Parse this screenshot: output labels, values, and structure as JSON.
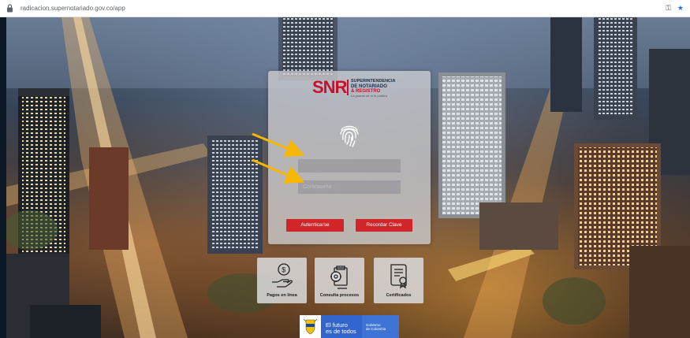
{
  "browser": {
    "url": "radicacion.supernotariado.gov.co/app"
  },
  "logo": {
    "acronym": "SNR",
    "line1": "SUPERINTENDENCIA",
    "line2": "DE NOTARIADO",
    "line3": "& REGISTRO",
    "tagline": "La guarda de la fe pública"
  },
  "login": {
    "username_value": "",
    "password_value": "",
    "password_placeholder": "Contraseña"
  },
  "buttons": {
    "authenticate": "Autenticarse",
    "recover": "Recordar Clave"
  },
  "services": [
    {
      "label": "Pagos en línea",
      "icon": "online-payment-icon"
    },
    {
      "label": "Consulta procesos",
      "icon": "process-lookup-icon"
    },
    {
      "label": "Certificados",
      "icon": "certificate-icon"
    }
  ],
  "gov_banner": {
    "slogan_line1": "El futuro",
    "slogan_line2": "es de todos",
    "entity_line1": "Gobierno",
    "entity_line2": "de Colombia"
  },
  "colors": {
    "brand_red": "#d0262a",
    "arrow_yellow": "#f5b700",
    "gov_blue": "#3366cc"
  }
}
